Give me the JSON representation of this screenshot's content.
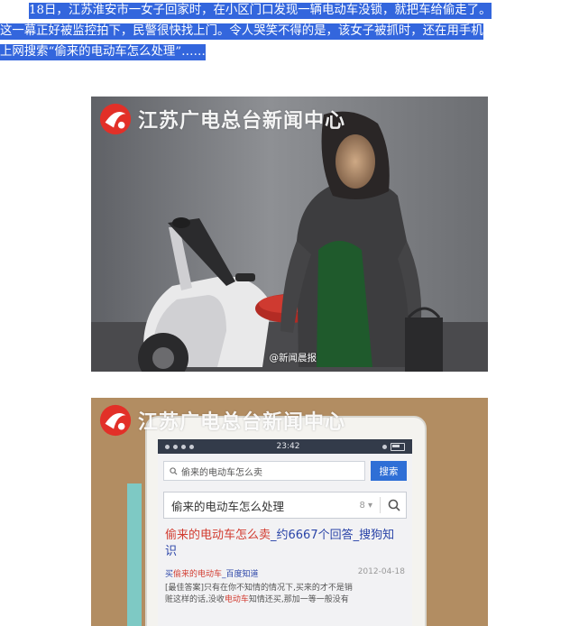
{
  "article": {
    "line1": "18日，江苏淮安市一女子回家时，在小区门口发现一辆电动车没锁，就把车给偷走了。",
    "line2": "这一幕正好被监控拍下，民警很快找上门。令人哭笑不得的是，该女子被抓时，还在用手机",
    "line3": "上网搜索“偷来的电动车怎么处理”……"
  },
  "image1": {
    "watermark": "江苏广电总台新闻中心",
    "credit": "@新闻晨报"
  },
  "image2": {
    "watermark": "江苏广电总台新闻中心",
    "phone": {
      "time": "23:42",
      "search_query": "偷来的电动车怎么卖",
      "search_button": "搜索",
      "sogou_query": "偷来的电动车怎么处理",
      "result_title_hl": "偷来的电动车怎么卖",
      "result_title_rest": "_约6667个回答_搜狗知识",
      "sub_prefix": "买",
      "sub_hl": "偷来的电动车",
      "sub_rest": "_百度知道",
      "sub_date": "2012-04-18",
      "body_1": "[最佳答案]只有在你不知情的情况下,买来的才不是销",
      "body_2_a": "赃这样的话,没收",
      "body_2_hl": "电动车",
      "body_2_b": "知情还买,那加一等一般没有"
    }
  },
  "colors": {
    "highlight": "#3366dd",
    "search_button": "#2f6fd6",
    "result_link": "#2a44a8",
    "result_em": "#d23c30"
  }
}
